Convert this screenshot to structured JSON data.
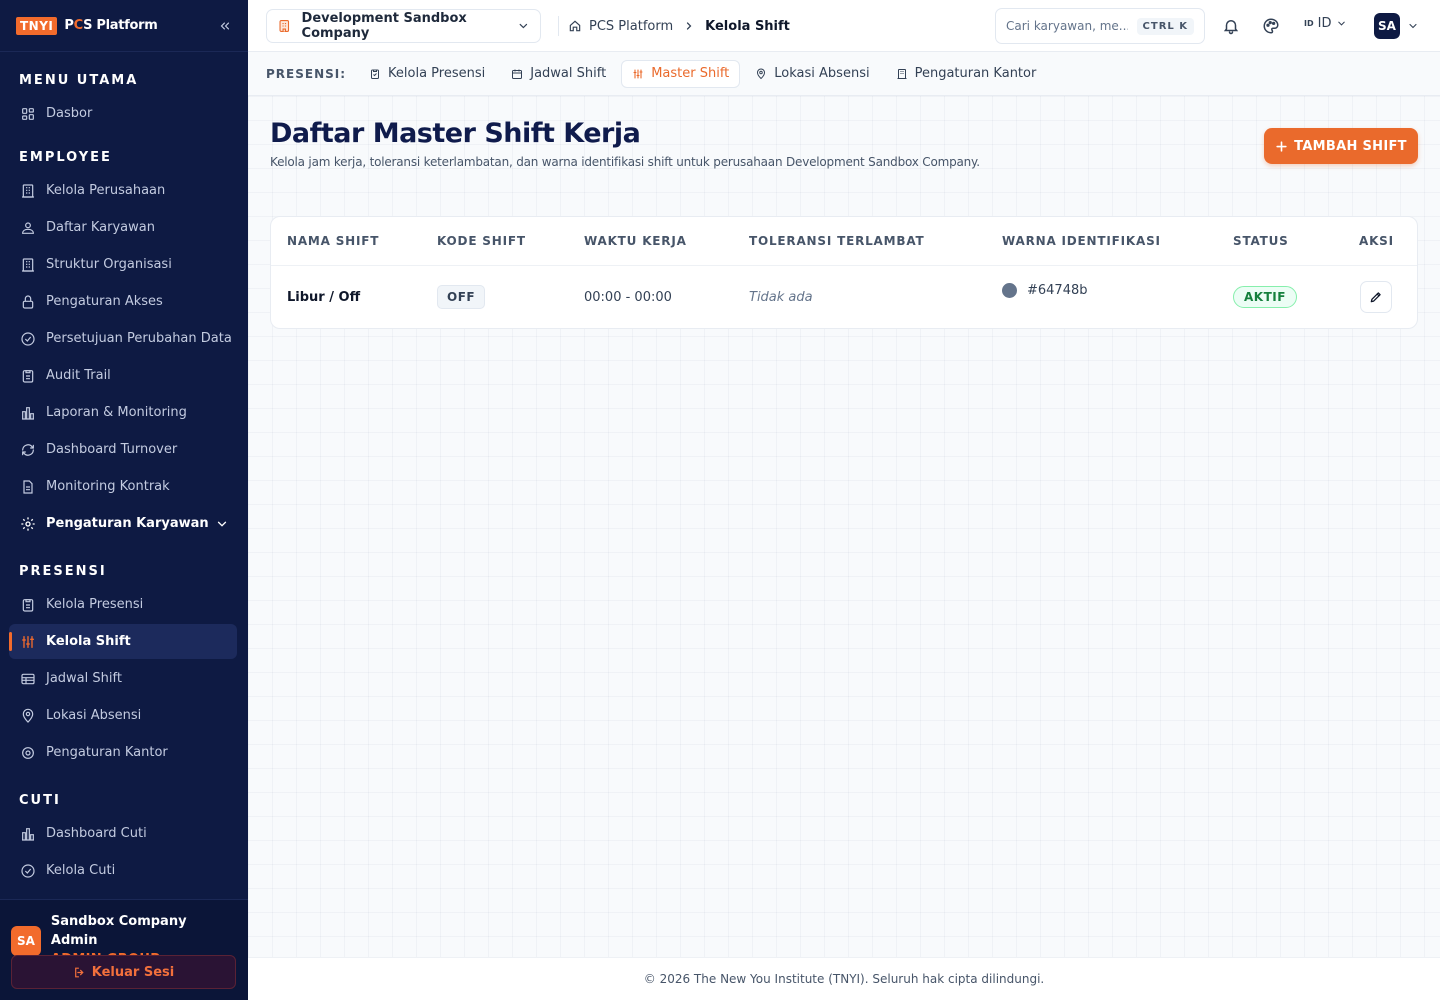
{
  "brand": {
    "badge": "TNYI",
    "name_p": "P",
    "name_c": "C",
    "name_rest": "S Platform"
  },
  "sidebar": {
    "sections": [
      {
        "title": "MENU UTAMA",
        "items": [
          {
            "label": "Dasbor",
            "icon": "grid-icon"
          }
        ]
      },
      {
        "title": "EMPLOYEE",
        "items": [
          {
            "label": "Kelola Perusahaan",
            "icon": "building-icon"
          },
          {
            "label": "Daftar Karyawan",
            "icon": "users-icon"
          },
          {
            "label": "Struktur Organisasi",
            "icon": "building-icon"
          },
          {
            "label": "Pengaturan Akses",
            "icon": "lock-icon"
          },
          {
            "label": "Persetujuan Perubahan Data",
            "icon": "check-circle-icon"
          },
          {
            "label": "Audit Trail",
            "icon": "clipboard-icon"
          },
          {
            "label": "Laporan & Monitoring",
            "icon": "bar-chart-icon"
          },
          {
            "label": "Dashboard Turnover",
            "icon": "refresh-icon"
          },
          {
            "label": "Monitoring Kontrak",
            "icon": "file-icon"
          },
          {
            "label": "Pengaturan Karyawan",
            "icon": "gear-icon"
          }
        ]
      },
      {
        "title": "PRESENSI",
        "items": [
          {
            "label": "Kelola Presensi",
            "icon": "clipboard-icon"
          },
          {
            "label": "Kelola Shift",
            "icon": "sliders-icon"
          },
          {
            "label": "Jadwal Shift",
            "icon": "table-icon"
          },
          {
            "label": "Lokasi Absensi",
            "icon": "map-pin-icon"
          },
          {
            "label": "Pengaturan Kantor",
            "icon": "gear-icon"
          }
        ]
      },
      {
        "title": "CUTI",
        "items": [
          {
            "label": "Dashboard Cuti",
            "icon": "bar-chart-icon"
          },
          {
            "label": "Kelola Cuti",
            "icon": "check-circle-icon"
          }
        ]
      }
    ],
    "user": {
      "initials": "SA",
      "name": "Sandbox Company Admin",
      "role": "ADMIN GROUP"
    },
    "logout_label": "Keluar Sesi"
  },
  "topbar": {
    "company": "Development Sandbox Company",
    "breadcrumb": {
      "root": "PCS Platform",
      "current": "Kelola Shift"
    },
    "search_placeholder": "Cari karyawan, me...",
    "search_shortcut": "CTRL K",
    "lang_flag": "ID",
    "lang_label": "ID",
    "avatar": "SA"
  },
  "subnav": {
    "label": "PRESENSI:",
    "tabs": [
      {
        "label": "Kelola Presensi",
        "icon": "clipboard-icon"
      },
      {
        "label": "Jadwal Shift",
        "icon": "calendar-icon"
      },
      {
        "label": "Master Shift",
        "icon": "sliders-icon"
      },
      {
        "label": "Lokasi Absensi",
        "icon": "map-pin-icon"
      },
      {
        "label": "Pengaturan Kantor",
        "icon": "building-icon"
      }
    ]
  },
  "main": {
    "title": "Daftar Master Shift Kerja",
    "subtitle": "Kelola jam kerja, toleransi keterlambatan, dan warna identifikasi shift untuk perusahaan Development Sandbox Company.",
    "add_button": "TAMBAH SHIFT",
    "table": {
      "headers": [
        "NAMA SHIFT",
        "KODE SHIFT",
        "WAKTU KERJA",
        "TOLERANSI TERLAMBAT",
        "WARNA IDENTIFIKASI",
        "STATUS",
        "AKSI"
      ],
      "rows": [
        {
          "name": "Libur / Off",
          "code": "OFF",
          "time": "00:00 - 00:00",
          "tolerance": "Tidak ada",
          "color": "#64748b",
          "status": "AKTIF"
        }
      ]
    }
  },
  "footer": "© 2026 The New You Institute (TNYI). Seluruh hak cipta dilindungi."
}
